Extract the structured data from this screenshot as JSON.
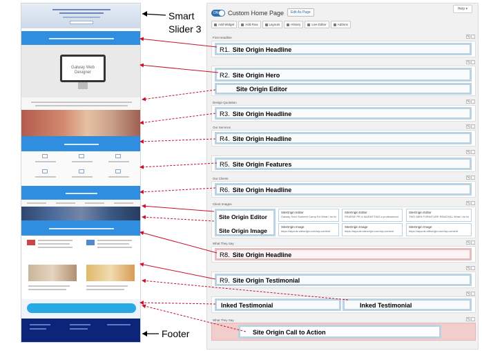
{
  "side_labels": {
    "smart_slider": "Smart\nSlider 3",
    "footer": "Footer"
  },
  "editor": {
    "help": "Help ▾",
    "toggle_on": "ON",
    "page_title": "Custom Home Page",
    "edit_as_page": "Edit As Page",
    "toolbar": [
      "Add Widget",
      "Add Row",
      "Layouts",
      "History",
      "Live Editor",
      "Addons"
    ]
  },
  "rows": [
    {
      "title": "First Headline",
      "widget": "Site Origin Headline",
      "num": "R1."
    },
    {
      "title": "",
      "widget": "Site Origin Hero",
      "num": "R2."
    },
    {
      "title": "",
      "widget": "Site Origin Editor",
      "num": ""
    },
    {
      "title": "Design Quotation",
      "widget": "Site Origin Headline",
      "num": "R3."
    },
    {
      "title": "Our Services",
      "widget": "Site Origin Headline",
      "num": "R4."
    },
    {
      "title": "",
      "widget": "Site Origin Features",
      "num": "R5."
    },
    {
      "title": "Our Clients",
      "widget": "Site Origin Headline",
      "num": "R6."
    },
    {
      "title": "Client Images",
      "widget": "",
      "num": ""
    },
    {
      "title": "What They Say",
      "widget": "Site Origin Headline",
      "num": "R8."
    },
    {
      "title": "",
      "widget": "Site Origin Testimonial",
      "num": "R9."
    },
    {
      "title": "",
      "widget": "Inked Testimonial",
      "num": ""
    },
    {
      "title": "What They Say",
      "widget": "Site Origin Call to Action",
      "num": ""
    }
  ],
  "client_images": {
    "left_editor": "Site Origin Editor",
    "left_image": "Site Origin Image",
    "editor_title": "SiteOrigin Editor",
    "editor_subs": [
      "Galway Tech Summer Camp Ed What I do for",
      "PEARSE PR & MARKETING a professional",
      "TWO MEN FURNITURE REMOVAL What I do for"
    ],
    "image_title": "SiteOrigin Image",
    "image_subs": [
      "https://layouts.siteorigin.com/wp-content",
      "https://layouts.siteorigin.com/wp-content",
      "https://layouts.siteorigin.com/wp-content"
    ]
  },
  "inked": [
    "Inked Testimonial",
    "Inked Testimonial"
  ],
  "preview": {
    "hero_text": "Galway Web\nDesigner",
    "banner1": "INSPIRING YOUR BUSINESS WITH OUR DESIGNS",
    "services": "OUR SERVICES",
    "clients": "OUR CLIENTS",
    "testimonials": "TESTIMONIALS & TRACK RECORD"
  },
  "colors": {
    "accent_blue": "#2f8ee0",
    "widget_border": "#b9d3e2",
    "pink_highlight": "#f3cccc",
    "arrow_red": "#c8102e",
    "footer_blue": "#0c2579"
  }
}
